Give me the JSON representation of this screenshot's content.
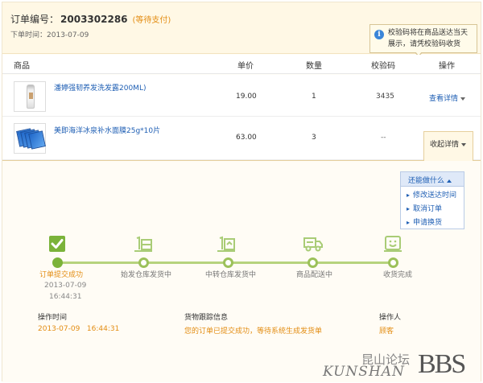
{
  "order": {
    "label": "订单编号：",
    "number": "2003302286",
    "status": "(等待支付)",
    "time_label": "下单时间：",
    "time": "2013-07-09"
  },
  "tip": {
    "icon": "info-icon",
    "text": "校验码将在商品送达当天展示，请凭校验码收货"
  },
  "table": {
    "headers": [
      "商品",
      "单价",
      "数量",
      "校验码",
      "操作"
    ],
    "rows": [
      {
        "name": "潘婷强韧养发洗发露200ML)",
        "price": "19.00",
        "qty": "1",
        "code": "3435",
        "action": "查看详情"
      },
      {
        "name": "美即海洋冰泉补水面膜25g*10片",
        "price": "63.00",
        "qty": "3",
        "code": "--",
        "action": "收起详情"
      }
    ]
  },
  "menu": {
    "title": "还能做什么",
    "items": [
      "修改送达时间",
      "取消订单",
      "申请换货"
    ]
  },
  "progress": {
    "steps": [
      {
        "label": "订单提交成功",
        "icon": "check-icon",
        "date": "2013-07-09",
        "time": "16:44:31",
        "done": true
      },
      {
        "label": "始发仓库发货中",
        "icon": "warehouse-icon",
        "done": false
      },
      {
        "label": "中转仓库发货中",
        "icon": "transfer-warehouse-icon",
        "done": false
      },
      {
        "label": "商品配送中",
        "icon": "truck-icon",
        "done": false
      },
      {
        "label": "收货完成",
        "icon": "smile-icon",
        "done": false
      }
    ]
  },
  "log": {
    "headers": [
      "操作时间",
      "货物跟踪信息",
      "操作人"
    ],
    "time": "2013-07-09   16:44:31",
    "info": "您的订单已提交成功，等待系统生成发货单",
    "operator": "顾客"
  },
  "watermark": {
    "cn": "昆山论坛",
    "en": "KUNSHAN",
    "bbs": "BBS"
  },
  "colors": {
    "accent_orange": "#e38d13",
    "link_blue": "#1f5fb4",
    "progress_green": "#7bb33a"
  }
}
